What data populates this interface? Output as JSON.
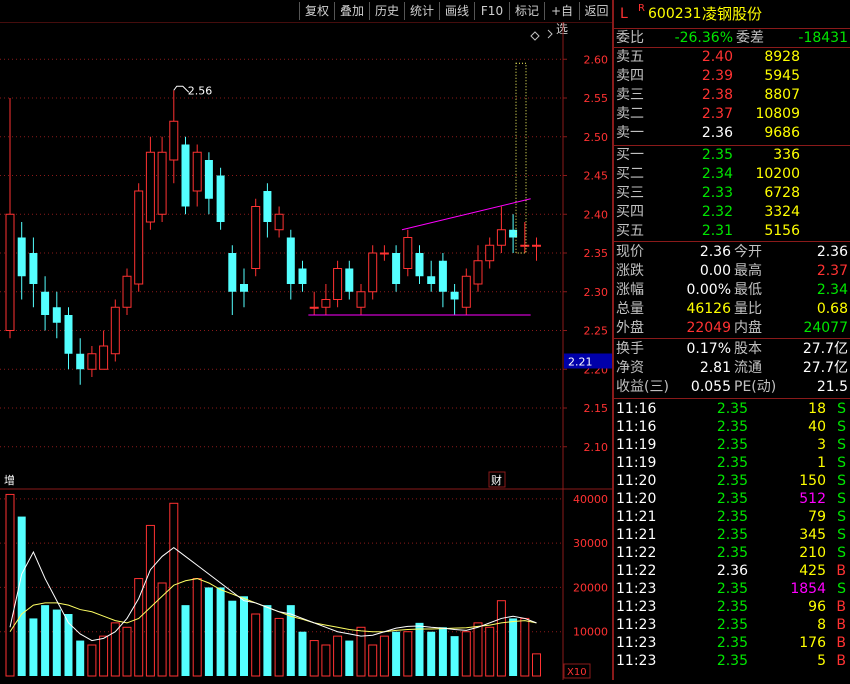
{
  "toolbar": {
    "buttons": [
      "复权",
      "叠加",
      "历史",
      "统计",
      "画线",
      "F10",
      "标记",
      "+自选",
      "返回"
    ]
  },
  "quote": {
    "mark_l": "L",
    "mark_r": "R",
    "code": "600231",
    "name": "凌钢股份",
    "webi_label": "委比",
    "webi_value": "-26.36%",
    "weicha_label": "委差",
    "weicha_value": "-18431",
    "asks": [
      {
        "label": "卖五",
        "price": "2.40",
        "vol": "8928"
      },
      {
        "label": "卖四",
        "price": "2.39",
        "vol": "5945"
      },
      {
        "label": "卖三",
        "price": "2.38",
        "vol": "8807"
      },
      {
        "label": "卖二",
        "price": "2.37",
        "vol": "10809"
      },
      {
        "label": "卖一",
        "price": "2.36",
        "vol": "9686"
      }
    ],
    "bids": [
      {
        "label": "买一",
        "price": "2.35",
        "vol": "336"
      },
      {
        "label": "买二",
        "price": "2.34",
        "vol": "10200"
      },
      {
        "label": "买三",
        "price": "2.33",
        "vol": "6728"
      },
      {
        "label": "买四",
        "price": "2.32",
        "vol": "3324"
      },
      {
        "label": "买五",
        "price": "2.31",
        "vol": "5156"
      }
    ],
    "stats": [
      {
        "l1": "现价",
        "v1": "2.36",
        "l2": "今开",
        "v2": "2.36"
      },
      {
        "l1": "涨跌",
        "v1": "0.00",
        "l2": "最高",
        "v2": "2.37"
      },
      {
        "l1": "涨幅",
        "v1": "0.00%",
        "l2": "最低",
        "v2": "2.34"
      },
      {
        "l1": "总量",
        "v1": "46126",
        "l2": "量比",
        "v2": "0.68"
      },
      {
        "l1": "外盘",
        "v1": "22049",
        "l2": "内盘",
        "v2": "24077"
      }
    ],
    "fin": [
      {
        "l1": "换手",
        "v1": "0.17%",
        "l2": "股本",
        "v2": "27.7亿"
      },
      {
        "l1": "净资",
        "v1": "2.81",
        "l2": "流通",
        "v2": "27.7亿"
      },
      {
        "l1": "收益(三)",
        "v1": "0.055",
        "l2": "PE(动)",
        "v2": "21.5"
      }
    ],
    "ticks": [
      {
        "time": "11:16",
        "price": "2.35",
        "vol": "18",
        "bs": "S"
      },
      {
        "time": "11:16",
        "price": "2.35",
        "vol": "40",
        "bs": "S"
      },
      {
        "time": "11:19",
        "price": "2.35",
        "vol": "3",
        "bs": "S"
      },
      {
        "time": "11:19",
        "price": "2.35",
        "vol": "1",
        "bs": "S"
      },
      {
        "time": "11:20",
        "price": "2.35",
        "vol": "150",
        "bs": "S"
      },
      {
        "time": "11:20",
        "price": "2.35",
        "vol": "512",
        "bs": "S"
      },
      {
        "time": "11:21",
        "price": "2.35",
        "vol": "79",
        "bs": "S"
      },
      {
        "time": "11:21",
        "price": "2.35",
        "vol": "345",
        "bs": "S"
      },
      {
        "time": "11:22",
        "price": "2.35",
        "vol": "210",
        "bs": "S"
      },
      {
        "time": "11:22",
        "price": "2.36",
        "vol": "425",
        "bs": "B"
      },
      {
        "time": "11:23",
        "price": "2.35",
        "vol": "1854",
        "bs": "S"
      },
      {
        "time": "11:23",
        "price": "2.35",
        "vol": "96",
        "bs": "B"
      },
      {
        "time": "11:23",
        "price": "2.35",
        "vol": "8",
        "bs": "B"
      },
      {
        "time": "11:23",
        "price": "2.35",
        "vol": "176",
        "bs": "B"
      },
      {
        "time": "11:23",
        "price": "2.35",
        "vol": "5",
        "bs": "B"
      }
    ]
  },
  "colors": {
    "up": "#ff3232",
    "down": "#54ffff",
    "grid": "#8a1a1a",
    "axis_text": "#ff3232",
    "ma_white": "#ffffff",
    "ma_yellow": "#ffff64",
    "trendline": "#ff00ff",
    "price_tag_bg": "#0000aa"
  },
  "chart_data": {
    "type": "candlestick",
    "price_axis": {
      "ticks": [
        "2.60",
        "2.55",
        "2.50",
        "2.45",
        "2.40",
        "2.35",
        "2.30",
        "2.25",
        "2.20",
        "2.15",
        "2.10"
      ],
      "ylim": [
        2.07,
        2.63
      ]
    },
    "current_price_tag": "2.21",
    "high_annotation": "2.56",
    "marker_zeng": "增",
    "marker_cai": "财",
    "candles": [
      {
        "o": 2.25,
        "c": 2.4,
        "h": 2.55,
        "l": 2.24
      },
      {
        "o": 2.37,
        "c": 2.32,
        "h": 2.39,
        "l": 2.29
      },
      {
        "o": 2.35,
        "c": 2.31,
        "h": 2.37,
        "l": 2.28
      },
      {
        "o": 2.3,
        "c": 2.27,
        "h": 2.32,
        "l": 2.25
      },
      {
        "o": 2.28,
        "c": 2.26,
        "h": 2.3,
        "l": 2.24
      },
      {
        "o": 2.27,
        "c": 2.22,
        "h": 2.28,
        "l": 2.2
      },
      {
        "o": 2.22,
        "c": 2.2,
        "h": 2.24,
        "l": 2.18
      },
      {
        "o": 2.2,
        "c": 2.22,
        "h": 2.23,
        "l": 2.19
      },
      {
        "o": 2.2,
        "c": 2.23,
        "h": 2.25,
        "l": 2.2
      },
      {
        "o": 2.22,
        "c": 2.28,
        "h": 2.29,
        "l": 2.21
      },
      {
        "o": 2.28,
        "c": 2.32,
        "h": 2.33,
        "l": 2.27
      },
      {
        "o": 2.31,
        "c": 2.43,
        "h": 2.44,
        "l": 2.3
      },
      {
        "o": 2.39,
        "c": 2.48,
        "h": 2.5,
        "l": 2.38
      },
      {
        "o": 2.4,
        "c": 2.48,
        "h": 2.5,
        "l": 2.39
      },
      {
        "o": 2.47,
        "c": 2.52,
        "h": 2.56,
        "l": 2.44
      },
      {
        "o": 2.49,
        "c": 2.41,
        "h": 2.5,
        "l": 2.4
      },
      {
        "o": 2.43,
        "c": 2.48,
        "h": 2.49,
        "l": 2.41
      },
      {
        "o": 2.47,
        "c": 2.42,
        "h": 2.48,
        "l": 2.4
      },
      {
        "o": 2.45,
        "c": 2.39,
        "h": 2.46,
        "l": 2.38
      },
      {
        "o": 2.35,
        "c": 2.3,
        "h": 2.36,
        "l": 2.27
      },
      {
        "o": 2.31,
        "c": 2.3,
        "h": 2.33,
        "l": 2.28
      },
      {
        "o": 2.33,
        "c": 2.41,
        "h": 2.42,
        "l": 2.32
      },
      {
        "o": 2.43,
        "c": 2.39,
        "h": 2.44,
        "l": 2.37
      },
      {
        "o": 2.38,
        "c": 2.4,
        "h": 2.41,
        "l": 2.37
      },
      {
        "o": 2.37,
        "c": 2.31,
        "h": 2.38,
        "l": 2.29
      },
      {
        "o": 2.33,
        "c": 2.31,
        "h": 2.34,
        "l": 2.3
      },
      {
        "o": 2.28,
        "c": 2.28,
        "h": 2.3,
        "l": 2.27
      },
      {
        "o": 2.28,
        "c": 2.29,
        "h": 2.31,
        "l": 2.27
      },
      {
        "o": 2.29,
        "c": 2.33,
        "h": 2.34,
        "l": 2.28
      },
      {
        "o": 2.33,
        "c": 2.3,
        "h": 2.34,
        "l": 2.29
      },
      {
        "o": 2.28,
        "c": 2.3,
        "h": 2.31,
        "l": 2.27
      },
      {
        "o": 2.3,
        "c": 2.35,
        "h": 2.36,
        "l": 2.29
      },
      {
        "o": 2.35,
        "c": 2.35,
        "h": 2.36,
        "l": 2.34
      },
      {
        "o": 2.35,
        "c": 2.31,
        "h": 2.36,
        "l": 2.3
      },
      {
        "o": 2.33,
        "c": 2.37,
        "h": 2.38,
        "l": 2.32
      },
      {
        "o": 2.35,
        "c": 2.32,
        "h": 2.36,
        "l": 2.31
      },
      {
        "o": 2.32,
        "c": 2.31,
        "h": 2.34,
        "l": 2.3
      },
      {
        "o": 2.34,
        "c": 2.3,
        "h": 2.35,
        "l": 2.28
      },
      {
        "o": 2.3,
        "c": 2.29,
        "h": 2.31,
        "l": 2.27
      },
      {
        "o": 2.28,
        "c": 2.32,
        "h": 2.33,
        "l": 2.27
      },
      {
        "o": 2.31,
        "c": 2.34,
        "h": 2.36,
        "l": 2.3
      },
      {
        "o": 2.34,
        "c": 2.36,
        "h": 2.37,
        "l": 2.33
      },
      {
        "o": 2.36,
        "c": 2.38,
        "h": 2.41,
        "l": 2.35
      },
      {
        "o": 2.38,
        "c": 2.37,
        "h": 2.4,
        "l": 2.35
      },
      {
        "o": 2.36,
        "c": 2.36,
        "h": 2.39,
        "l": 2.35
      },
      {
        "o": 2.36,
        "c": 2.36,
        "h": 2.37,
        "l": 2.34
      }
    ],
    "volume_axis": {
      "ticks": [
        "40000",
        "30000",
        "20000",
        "10000"
      ],
      "ylim": [
        0,
        42000
      ],
      "unit": "X10"
    },
    "volumes": [
      41000,
      36000,
      13000,
      16000,
      15000,
      14000,
      8000,
      7000,
      9000,
      12000,
      11000,
      22000,
      34000,
      21000,
      39000,
      16000,
      22000,
      20000,
      20000,
      17000,
      18000,
      14000,
      16000,
      13000,
      16000,
      10000,
      8000,
      7000,
      9000,
      8000,
      11000,
      7000,
      9000,
      10000,
      10000,
      12000,
      10000,
      11000,
      9000,
      10000,
      12000,
      11000,
      17000,
      13000,
      13000,
      5000
    ],
    "ma_white": [
      11000,
      23000,
      28000,
      22000,
      17000,
      12000,
      9500,
      8000,
      8500,
      10000,
      13000,
      17500,
      24000,
      27000,
      29000,
      27000,
      25000,
      23000,
      21000,
      19000,
      17000,
      16500,
      15500,
      14500,
      14000,
      13000,
      12000,
      11000,
      10000,
      9500,
      9000,
      9200,
      10000,
      10800,
      11200,
      11300,
      11000,
      10800,
      10500,
      10300,
      11000,
      12000,
      13000,
      13500,
      13000,
      12000
    ],
    "ma_yellow": [
      10000,
      14000,
      16000,
      16500,
      16500,
      16000,
      15000,
      14500,
      13500,
      12500,
      12000,
      13000,
      15500,
      18000,
      20500,
      21500,
      22000,
      21000,
      19500,
      18500,
      17500,
      16500,
      15500,
      14500,
      13500,
      12800,
      12000,
      11500,
      11000,
      10500,
      10200,
      10000,
      10000,
      10300,
      10500,
      10600,
      10600,
      10700,
      10800,
      10900,
      11200,
      11500,
      12000,
      12300,
      12500,
      12000
    ]
  }
}
